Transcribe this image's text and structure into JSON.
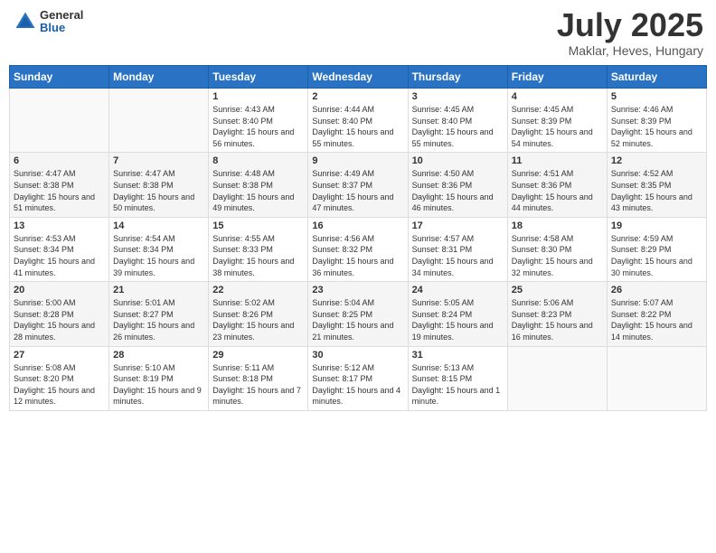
{
  "header": {
    "logo": {
      "general": "General",
      "blue": "Blue"
    },
    "title": "July 2025",
    "location": "Maklar, Heves, Hungary"
  },
  "days_of_week": [
    "Sunday",
    "Monday",
    "Tuesday",
    "Wednesday",
    "Thursday",
    "Friday",
    "Saturday"
  ],
  "weeks": [
    [
      {
        "day": "",
        "info": ""
      },
      {
        "day": "",
        "info": ""
      },
      {
        "day": "1",
        "sunrise": "4:43 AM",
        "sunset": "8:40 PM",
        "daylight": "15 hours and 56 minutes."
      },
      {
        "day": "2",
        "sunrise": "4:44 AM",
        "sunset": "8:40 PM",
        "daylight": "15 hours and 55 minutes."
      },
      {
        "day": "3",
        "sunrise": "4:45 AM",
        "sunset": "8:40 PM",
        "daylight": "15 hours and 55 minutes."
      },
      {
        "day": "4",
        "sunrise": "4:45 AM",
        "sunset": "8:39 PM",
        "daylight": "15 hours and 54 minutes."
      },
      {
        "day": "5",
        "sunrise": "4:46 AM",
        "sunset": "8:39 PM",
        "daylight": "15 hours and 52 minutes."
      }
    ],
    [
      {
        "day": "6",
        "sunrise": "4:47 AM",
        "sunset": "8:38 PM",
        "daylight": "15 hours and 51 minutes."
      },
      {
        "day": "7",
        "sunrise": "4:47 AM",
        "sunset": "8:38 PM",
        "daylight": "15 hours and 50 minutes."
      },
      {
        "day": "8",
        "sunrise": "4:48 AM",
        "sunset": "8:38 PM",
        "daylight": "15 hours and 49 minutes."
      },
      {
        "day": "9",
        "sunrise": "4:49 AM",
        "sunset": "8:37 PM",
        "daylight": "15 hours and 47 minutes."
      },
      {
        "day": "10",
        "sunrise": "4:50 AM",
        "sunset": "8:36 PM",
        "daylight": "15 hours and 46 minutes."
      },
      {
        "day": "11",
        "sunrise": "4:51 AM",
        "sunset": "8:36 PM",
        "daylight": "15 hours and 44 minutes."
      },
      {
        "day": "12",
        "sunrise": "4:52 AM",
        "sunset": "8:35 PM",
        "daylight": "15 hours and 43 minutes."
      }
    ],
    [
      {
        "day": "13",
        "sunrise": "4:53 AM",
        "sunset": "8:34 PM",
        "daylight": "15 hours and 41 minutes."
      },
      {
        "day": "14",
        "sunrise": "4:54 AM",
        "sunset": "8:34 PM",
        "daylight": "15 hours and 39 minutes."
      },
      {
        "day": "15",
        "sunrise": "4:55 AM",
        "sunset": "8:33 PM",
        "daylight": "15 hours and 38 minutes."
      },
      {
        "day": "16",
        "sunrise": "4:56 AM",
        "sunset": "8:32 PM",
        "daylight": "15 hours and 36 minutes."
      },
      {
        "day": "17",
        "sunrise": "4:57 AM",
        "sunset": "8:31 PM",
        "daylight": "15 hours and 34 minutes."
      },
      {
        "day": "18",
        "sunrise": "4:58 AM",
        "sunset": "8:30 PM",
        "daylight": "15 hours and 32 minutes."
      },
      {
        "day": "19",
        "sunrise": "4:59 AM",
        "sunset": "8:29 PM",
        "daylight": "15 hours and 30 minutes."
      }
    ],
    [
      {
        "day": "20",
        "sunrise": "5:00 AM",
        "sunset": "8:28 PM",
        "daylight": "15 hours and 28 minutes."
      },
      {
        "day": "21",
        "sunrise": "5:01 AM",
        "sunset": "8:27 PM",
        "daylight": "15 hours and 26 minutes."
      },
      {
        "day": "22",
        "sunrise": "5:02 AM",
        "sunset": "8:26 PM",
        "daylight": "15 hours and 23 minutes."
      },
      {
        "day": "23",
        "sunrise": "5:04 AM",
        "sunset": "8:25 PM",
        "daylight": "15 hours and 21 minutes."
      },
      {
        "day": "24",
        "sunrise": "5:05 AM",
        "sunset": "8:24 PM",
        "daylight": "15 hours and 19 minutes."
      },
      {
        "day": "25",
        "sunrise": "5:06 AM",
        "sunset": "8:23 PM",
        "daylight": "15 hours and 16 minutes."
      },
      {
        "day": "26",
        "sunrise": "5:07 AM",
        "sunset": "8:22 PM",
        "daylight": "15 hours and 14 minutes."
      }
    ],
    [
      {
        "day": "27",
        "sunrise": "5:08 AM",
        "sunset": "8:20 PM",
        "daylight": "15 hours and 12 minutes."
      },
      {
        "day": "28",
        "sunrise": "5:10 AM",
        "sunset": "8:19 PM",
        "daylight": "15 hours and 9 minutes."
      },
      {
        "day": "29",
        "sunrise": "5:11 AM",
        "sunset": "8:18 PM",
        "daylight": "15 hours and 7 minutes."
      },
      {
        "day": "30",
        "sunrise": "5:12 AM",
        "sunset": "8:17 PM",
        "daylight": "15 hours and 4 minutes."
      },
      {
        "day": "31",
        "sunrise": "5:13 AM",
        "sunset": "8:15 PM",
        "daylight": "15 hours and 1 minute."
      },
      {
        "day": "",
        "info": ""
      },
      {
        "day": "",
        "info": ""
      }
    ]
  ],
  "labels": {
    "sunrise": "Sunrise:",
    "sunset": "Sunset:",
    "daylight": "Daylight:"
  }
}
